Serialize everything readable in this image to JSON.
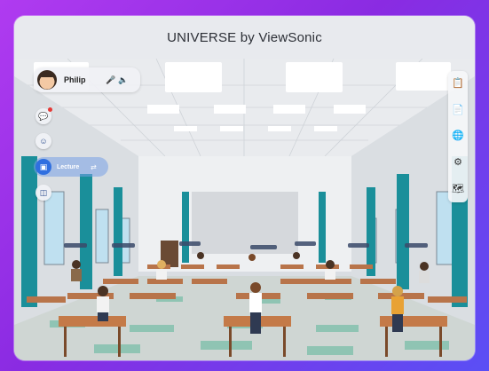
{
  "window": {
    "title": "UNIVERSE by ViewSonic"
  },
  "user": {
    "name": "Philip",
    "mic_icon": "microphone-icon",
    "speaker_icon": "speaker-icon"
  },
  "left_toolbar": {
    "chat_icon": "chat-bubbles-icon",
    "emoji_icon": "emoji-icon",
    "lecture": {
      "label": "Lecture",
      "icon": "lecture-board-icon",
      "swap_icon": "swap-icon"
    },
    "screen_icon": "screen-cast-icon"
  },
  "right_toolbar": {
    "items": [
      "clipboard-icon",
      "document-icon",
      "globe-icon",
      "settings-gear-icon",
      "map-icon"
    ]
  },
  "colors": {
    "background_gradient_start": "#b03bf0",
    "background_gradient_end": "#5a4ff5",
    "pillar_teal": "#1a8f9a",
    "lecture_blue": "#2f6fe0"
  }
}
